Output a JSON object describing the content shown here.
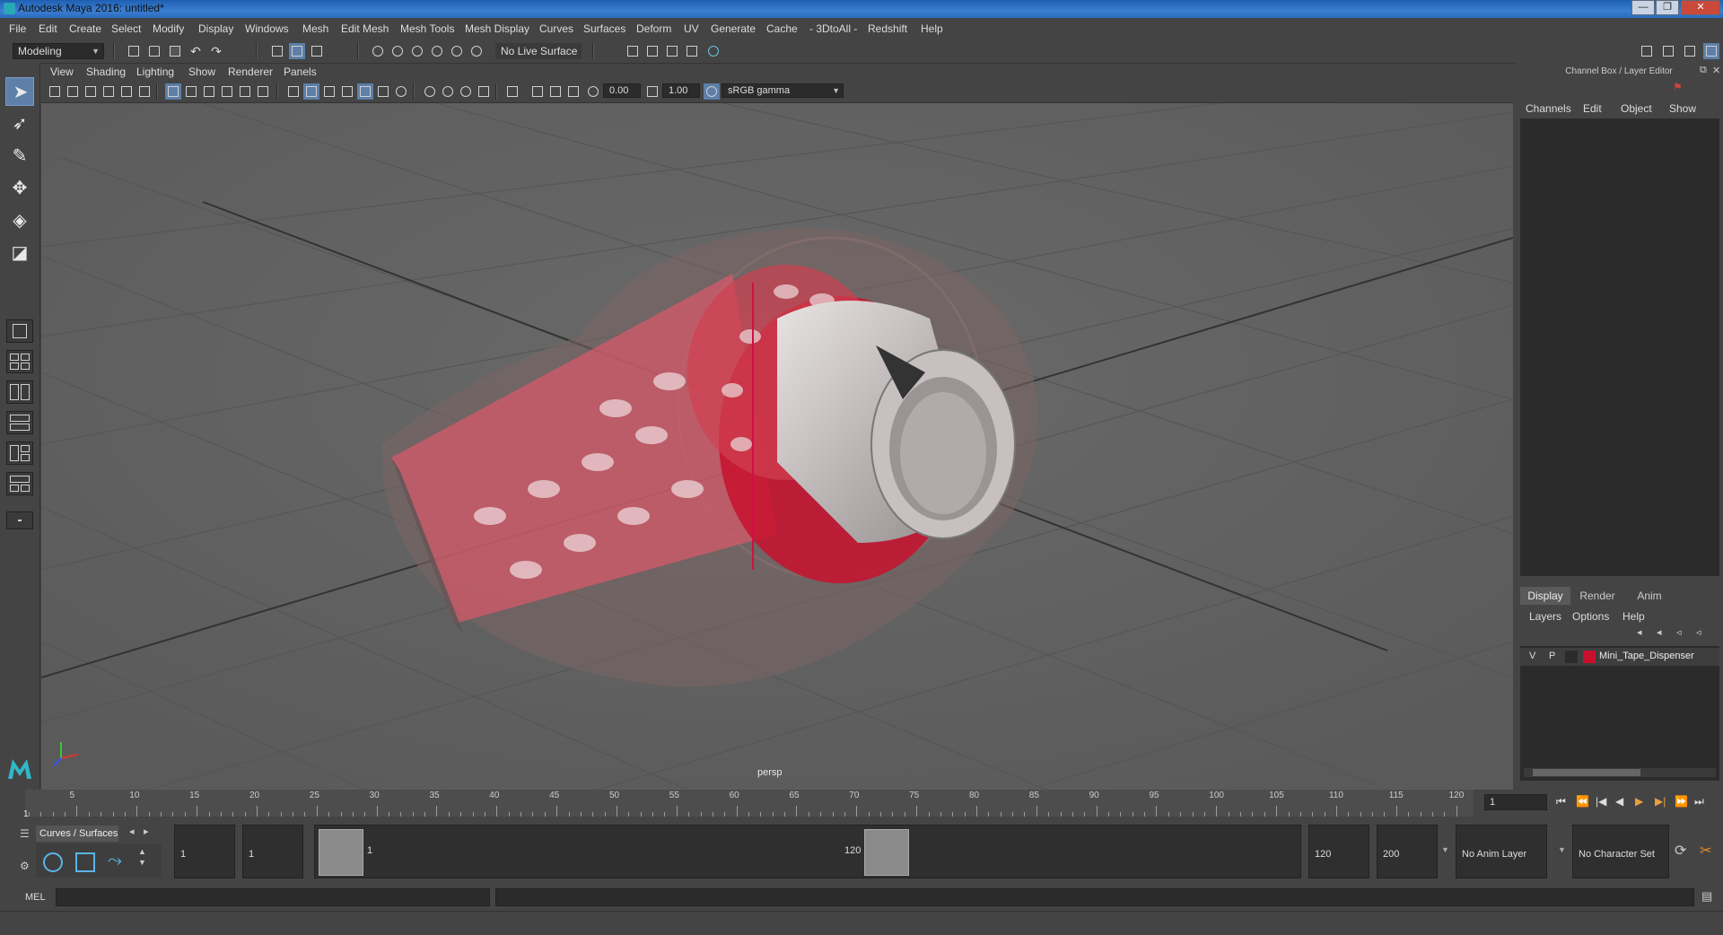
{
  "window": {
    "title": "Autodesk Maya 2016: untitled*",
    "buttons": [
      "—",
      "❐",
      "✕"
    ]
  },
  "menus": [
    "File",
    "Edit",
    "Create",
    "Select",
    "Modify",
    "Display",
    "Windows",
    "Mesh",
    "Edit Mesh",
    "Mesh Tools",
    "Mesh Display",
    "Curves",
    "Surfaces",
    "Deform",
    "UV",
    "Generate",
    "Cache",
    "- 3DtoAll -",
    "Redshift",
    "Help"
  ],
  "status_line": {
    "menu_set": "Modeling",
    "live_surface": "No Live Surface"
  },
  "viewport": {
    "menus": [
      "View",
      "Shading",
      "Lighting",
      "Show",
      "Renderer",
      "Panels"
    ],
    "exposure": "0.00",
    "gamma": "1.00",
    "color_space": "sRGB gamma",
    "camera_label": "persp"
  },
  "channel_box": {
    "title": "Channel Box / Layer Editor",
    "menus": [
      "Channels",
      "Edit",
      "Object",
      "Show"
    ]
  },
  "layer_editor": {
    "tabs": [
      "Display",
      "Render",
      "Anim"
    ],
    "active_tab": "Display",
    "menus": [
      "Layers",
      "Options",
      "Help"
    ],
    "layers": [
      {
        "visible": "V",
        "playback": "P",
        "color": "#c8102e",
        "name": "Mini_Tape_Dispenser"
      }
    ]
  },
  "timeline": {
    "labels": [
      "5",
      "10",
      "15",
      "20",
      "25",
      "30",
      "35",
      "40",
      "45",
      "50",
      "55",
      "60",
      "65",
      "70",
      "75",
      "80",
      "85",
      "90",
      "95",
      "100",
      "105",
      "110",
      "115",
      "120"
    ],
    "start_label": "1",
    "current_frame": "1"
  },
  "playback_controls": [
    "⏮",
    "⏪",
    "|◀",
    "◀",
    "▶",
    "▶|",
    "⏩",
    "⏭"
  ],
  "shelf": {
    "tab": "Curves / Surfaces"
  },
  "range_slider": {
    "start_time": "1",
    "playback_start": "1",
    "range_start": "1",
    "range_end": "120",
    "playback_end": "120",
    "end_time": "200",
    "anim_layer": "No Anim Layer",
    "character_set": "No Character Set"
  },
  "command_line": {
    "language": "MEL"
  },
  "colors": {
    "panel": "#444444",
    "viewport_bg": "#636363",
    "field": "#2b2b2b",
    "active_tool": "#5d7fa8",
    "tape_red": "#c8102e",
    "title_blue": "#2a6ac0"
  }
}
